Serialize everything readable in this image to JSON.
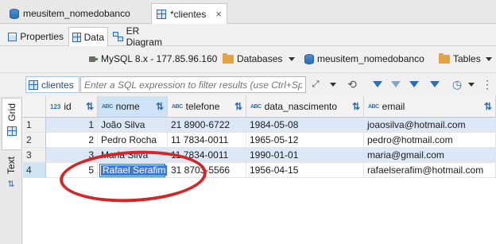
{
  "editor_tabs": [
    {
      "label": "meusitem_nomedobanco",
      "icon": "database-icon"
    },
    {
      "label": "*clientes",
      "icon": "table-icon",
      "close": "×"
    }
  ],
  "sub_tabs": [
    {
      "label": "Properties",
      "icon": "properties-icon"
    },
    {
      "label": "Data",
      "icon": "grid-icon"
    },
    {
      "label": "ER Diagram",
      "icon": "er-diagram-icon"
    }
  ],
  "connection": {
    "driver": "MySQL 8.x - 177.85.96.160",
    "databases": "Databases",
    "database": "meusitem_nomedobanco",
    "tables": "Tables"
  },
  "filter": {
    "table": "clientes",
    "placeholder": "Enter a SQL expression to filter results (use Ctrl+Space)"
  },
  "side_tabs": {
    "grid": "Grid",
    "text": "Text"
  },
  "grid": {
    "columns": [
      {
        "name": "id",
        "type_badge": "123"
      },
      {
        "name": "nome",
        "type_badge": "ABC"
      },
      {
        "name": "telefone",
        "type_badge": "ABC"
      },
      {
        "name": "data_nascimento",
        "type_badge": "ABC"
      },
      {
        "name": "email",
        "type_badge": "ABC"
      }
    ],
    "rows": [
      {
        "n": "1",
        "id": "1",
        "nome": "João Silva",
        "telefone": "21 8900-6722",
        "data_nascimento": "1984-05-08",
        "email": "joaosilva@hotmail.com"
      },
      {
        "n": "2",
        "id": "2",
        "nome": "Pedro Rocha",
        "telefone": "11 7834-0011",
        "data_nascimento": "1965-05-12",
        "email": "pedro@hotmail.com"
      },
      {
        "n": "3",
        "id": "3",
        "nome": "Maria Silva",
        "telefone": "11 7834-0011",
        "data_nascimento": "1990-01-01",
        "email": "maria@gmail.com"
      },
      {
        "n": "4",
        "id": "5",
        "nome": "Rafael Serafim",
        "telefone": "31 8703-5566",
        "data_nascimento": "1956-04-15",
        "email": "rafaelserafim@hotmail.com"
      }
    ]
  },
  "colors": {
    "accent": "#2d6db3",
    "annotation": "#d22727",
    "selected_row": "#dde8f6"
  }
}
